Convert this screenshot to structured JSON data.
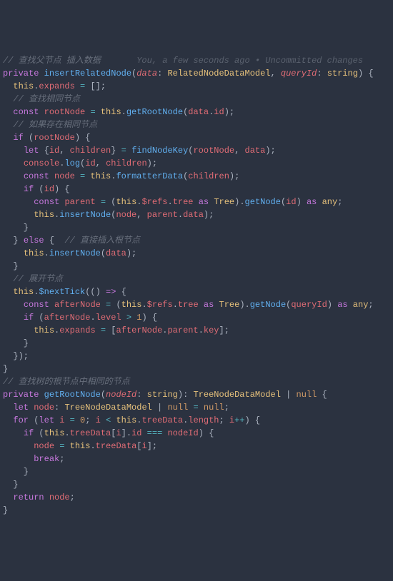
{
  "codelens": "You, a few seconds ago • Uncommitted changes",
  "comments": {
    "c1": "// 查找父节点 插入数据",
    "c2": "// 查找相同节点",
    "c3": "// 如果存在相同节点",
    "c4": "// 直接插入根节点",
    "c5": "// 展开节点",
    "c6": "// 查找树的根节点中相同的节点"
  },
  "tok": {
    "private": "private",
    "const": "const",
    "let": "let",
    "if": "if",
    "else": "else",
    "for": "for",
    "return": "return",
    "break": "break",
    "as": "as",
    "any": "any",
    "this": "this",
    "null": "null",
    "string": "string",
    "insertRelatedNode": "insertRelatedNode",
    "getRootNode": "getRootNode",
    "findNodeKey": "findNodeKey",
    "formatterData": "formatterData",
    "insertNode": "insertNode",
    "getNode": "getNode",
    "nextTick": "$nextTick",
    "data": "data",
    "queryId": "queryId",
    "nodeId": "nodeId",
    "RelatedNodeDataModel": "RelatedNodeDataModel",
    "TreeNodeDataModel": "TreeNodeDataModel",
    "Tree": "Tree",
    "expands": "expands",
    "rootNode": "rootNode",
    "id": "id",
    "children": "children",
    "node": "node",
    "parent": "parent",
    "refs": "$refs",
    "tree": "tree",
    "afterNode": "afterNode",
    "level": "level",
    "key": "key",
    "treeData": "treeData",
    "length": "length",
    "i": "i",
    "console": "console",
    "log": "log",
    "n0": "0",
    "n1": "1"
  }
}
